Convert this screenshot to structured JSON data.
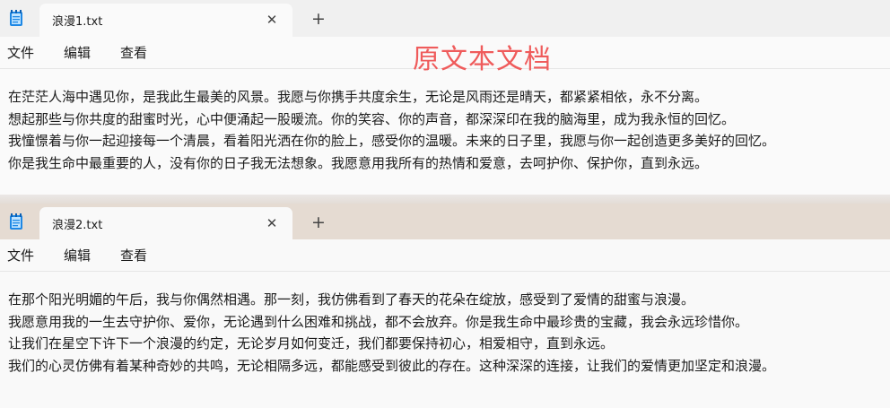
{
  "windows": [
    {
      "tab_title": "浪漫1.txt",
      "close_glyph": "✕",
      "new_tab_glyph": "+",
      "menu": [
        "文件",
        "编辑",
        "查看"
      ],
      "lines": [
        "在茫茫人海中遇见你，是我此生最美的风景。我愿与你携手共度余生，无论是风雨还是晴天，都紧紧相依，永不分离。",
        "想起那些与你共度的甜蜜时光，心中便涌起一股暖流。你的笑容、你的声音，都深深印在我的脑海里，成为我永恒的回忆。",
        "我憧憬着与你一起迎接每一个清晨，看着阳光洒在你的脸上，感受你的温暖。未来的日子里，我愿与你一起创造更多美好的回忆。",
        "你是我生命中最重要的人，没有你的日子我无法想象。我愿意用我所有的热情和爱意，去呵护你、保护你，直到永远。"
      ]
    },
    {
      "tab_title": "浪漫2.txt",
      "close_glyph": "✕",
      "new_tab_glyph": "+",
      "menu": [
        "文件",
        "编辑",
        "查看"
      ],
      "lines": [
        "在那个阳光明媚的午后，我与你偶然相遇。那一刻，我仿佛看到了春天的花朵在绽放，感受到了爱情的甜蜜与浪漫。",
        "我愿意用我的一生去守护你、爱你，无论遇到什么困难和挑战，都不会放弃。你是我生命中最珍贵的宝藏，我会永远珍惜你。",
        "让我们在星空下许下一个浪漫的约定，无论岁月如何变迁，我们都要保持初心，相爱相守，直到永远。",
        "我们的心灵仿佛有着某种奇妙的共鸣，无论相隔多远，都能感受到彼此的存在。这种深深的连接，让我们的爱情更加坚定和浪漫。"
      ]
    }
  ],
  "annotation": "原文本文档",
  "icons": {
    "app": "notepad-icon",
    "close": "close-icon",
    "add": "plus-icon"
  },
  "colors": {
    "annotation": "#ef5b5b",
    "notepad_blue": "#1e88e5"
  }
}
